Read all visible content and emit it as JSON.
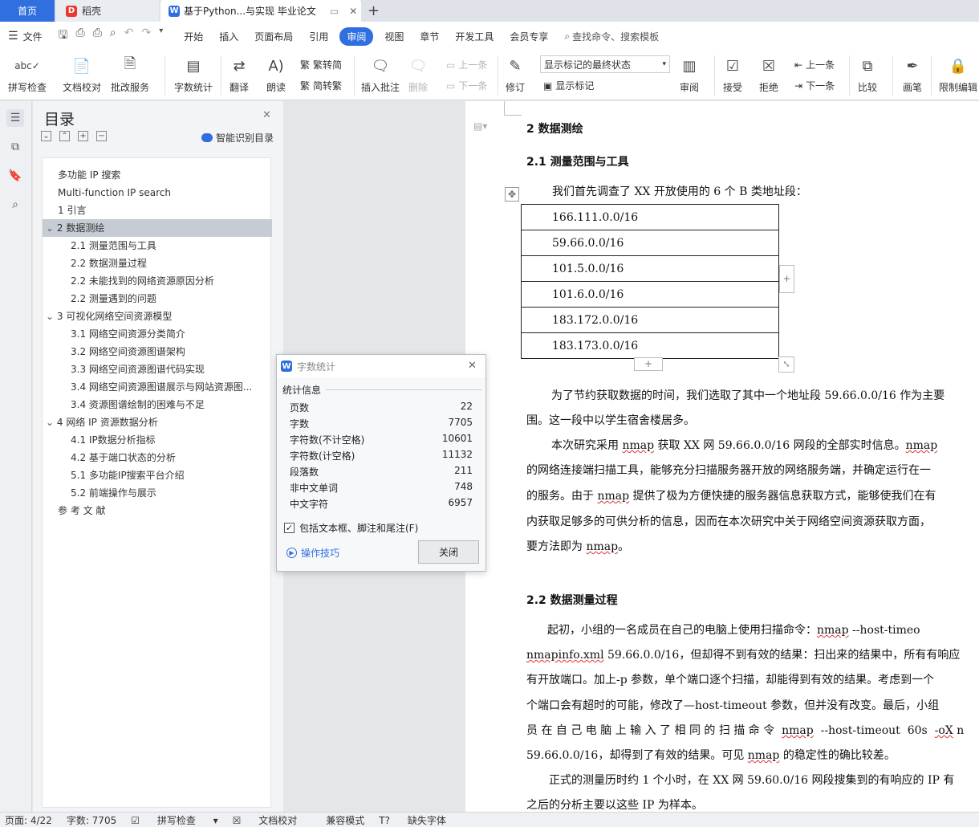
{
  "tabs": {
    "home": "首页",
    "daoke": "稻壳",
    "doc": "基于Python...与实现 毕业论文"
  },
  "menu": {
    "file": "文件",
    "items": [
      "开始",
      "插入",
      "页面布局",
      "引用",
      "审阅",
      "视图",
      "章节",
      "开发工具",
      "会员专享"
    ],
    "active": "审阅",
    "search": "查找命令、搜索模板"
  },
  "ribbon": {
    "spellcheck": "拼写检查",
    "proofread": "文档校对",
    "batch": "批改服务",
    "wordcount": "字数统计",
    "translate": "翻译",
    "read": "朗读",
    "trad": "繁转简",
    "simp": "简转繁",
    "insert_comment": "插入批注",
    "delete": "删除",
    "prev_comment": "上一条",
    "next_comment": "下一条",
    "revise": "修订",
    "show_mode": "显示标记的最终状态",
    "show_marks": "显示标记",
    "review": "审阅",
    "accept": "接受",
    "reject": "拒绝",
    "prev": "上一条",
    "next": "下一条",
    "compare": "比较",
    "pen": "画笔",
    "restrict": "限制编辑"
  },
  "nav": {
    "title": "目录",
    "smart": "智能识别目录",
    "toc": [
      {
        "text": "多功能 IP 搜索",
        "lvl": 0
      },
      {
        "text": "Multi-function IP search",
        "lvl": 0
      },
      {
        "text": "1  引言",
        "lvl": 0
      },
      {
        "text": "2  数据测绘",
        "lvl": 0,
        "open": true,
        "sel": true
      },
      {
        "text": "2.1    测量范围与工具",
        "lvl": 1
      },
      {
        "text": "2.2    数据测量过程",
        "lvl": 1
      },
      {
        "text": "2.2    未能找到的网络资源原因分析",
        "lvl": 1
      },
      {
        "text": "2.2    测量遇到的问题",
        "lvl": 1
      },
      {
        "text": "3  可视化网络空间资源模型",
        "lvl": 0,
        "open": true
      },
      {
        "text": "3.1    网络空间资源分类简介",
        "lvl": 1
      },
      {
        "text": "3.2    网络空间资源图谱架构",
        "lvl": 1
      },
      {
        "text": "3.3    网络空间资源图谱代码实现",
        "lvl": 1
      },
      {
        "text": "3.4    网络空间资源图谱展示与网站资源图...",
        "lvl": 1
      },
      {
        "text": "3.4    资源图谱绘制的困难与不足",
        "lvl": 1
      },
      {
        "text": "4  网络 IP 资源数据分析",
        "lvl": 0,
        "open": true
      },
      {
        "text": "4.1    IP数据分析指标",
        "lvl": 1
      },
      {
        "text": "4.2    基于端口状态的分析",
        "lvl": 1
      },
      {
        "text": "5.1    多功能IP搜索平台介绍",
        "lvl": 1
      },
      {
        "text": "5.2    前端操作与展示",
        "lvl": 1
      },
      {
        "text": "参 考 文 献",
        "lvl": 0
      }
    ]
  },
  "doc": {
    "h2": "2  数据测绘",
    "h21": "2.1    测量范围与工具",
    "intro": "我们首先调查了 XX 开放使用的 6 个 B 类地址段：",
    "ips": [
      "166.111.0.0/16",
      "59.66.0.0/16",
      "101.5.0.0/16",
      "101.6.0.0/16",
      "183.172.0.0/16",
      "183.173.0.0/16"
    ],
    "p1a": "为了节约获取数据的时间，我们选取了其中一个地址段 59.66.0.0/16 作为主要",
    "p1b": "围。这一段中以学生宿舍楼居多。",
    "p2a_pre": "本次研究采用 ",
    "p2a_post": " 获取 XX 网 59.66.0.0/16 网段的全部实时信息。",
    "p2b": "的网络连接端扫描工具，能够充分扫描服务器开放的网络服务端，并确定运行在一",
    "p2c_pre": "的服务。由于 ",
    "p2c_post": " 提供了极为方便快捷的服务器信息获取方式，能够使我们在有",
    "p3": "内获取足够多的可供分析的信息，因而在本次研究中关于网络空间资源获取方面，",
    "p4_pre": "要方法即为 ",
    "p4_post": "。",
    "nmap": "nmap",
    "h22": "2.2    数据测量过程",
    "q1_pre": "起初，小组的一名成员在自己的电脑上使用扫描命令：",
    "q1_post": " --host-timeo",
    "q2_file": "nmapinfo.xml",
    "q2_post": " 59.66.0.0/16，但却得不到有效的结果：扫出来的结果中，所有有响应",
    "q3": "有开放端口。加上-p 参数，单个端口逐个扫描，却能得到有效的结果。考虑到一个",
    "q4": "个端口会有超时的可能，修改了—host-timeout 参数，但并没有改变。最后，小组",
    "q5_pre": "员 在 自 己 电 脑 上 输 入 了 相 同 的 扫 描 命 令  ",
    "q5_post": "  --host-timeout  60s  ",
    "q5_ox": "-oX",
    "q5_end": " n",
    "q6_pre": "59.66.0.0/16，却得到了有效的结果。可见 ",
    "q6_post": " 的稳定性的确比较差。",
    "q7": "正式的测量历时约 1 个小时，在 XX 网 59.60.0/16 网段搜集到的有响应的 IP 有",
    "q8": "之后的分析主要以这些 IP 为样本。"
  },
  "dialog": {
    "title": "字数统计",
    "section": "统计信息",
    "rows": [
      {
        "label": "页数",
        "value": "22"
      },
      {
        "label": "字数",
        "value": "7705"
      },
      {
        "label": "字符数(不计空格)",
        "value": "10601"
      },
      {
        "label": "字符数(计空格)",
        "value": "11132"
      },
      {
        "label": "段落数",
        "value": "211"
      },
      {
        "label": "非中文单词",
        "value": "748"
      },
      {
        "label": "中文字符",
        "value": "6957"
      }
    ],
    "include": "包括文本框、脚注和尾注(F)",
    "tips": "操作技巧",
    "close": "关闭"
  },
  "status": {
    "page": "页面: 4/22",
    "words": "字数: 7705",
    "spell": "拼写检查",
    "proof": "文档校对",
    "compat": "兼容模式",
    "font": "缺失字体"
  },
  "colors": {
    "accent": "#2f6fe0",
    "selected": "#c6ccd4",
    "squiggle": "#dd3333"
  }
}
